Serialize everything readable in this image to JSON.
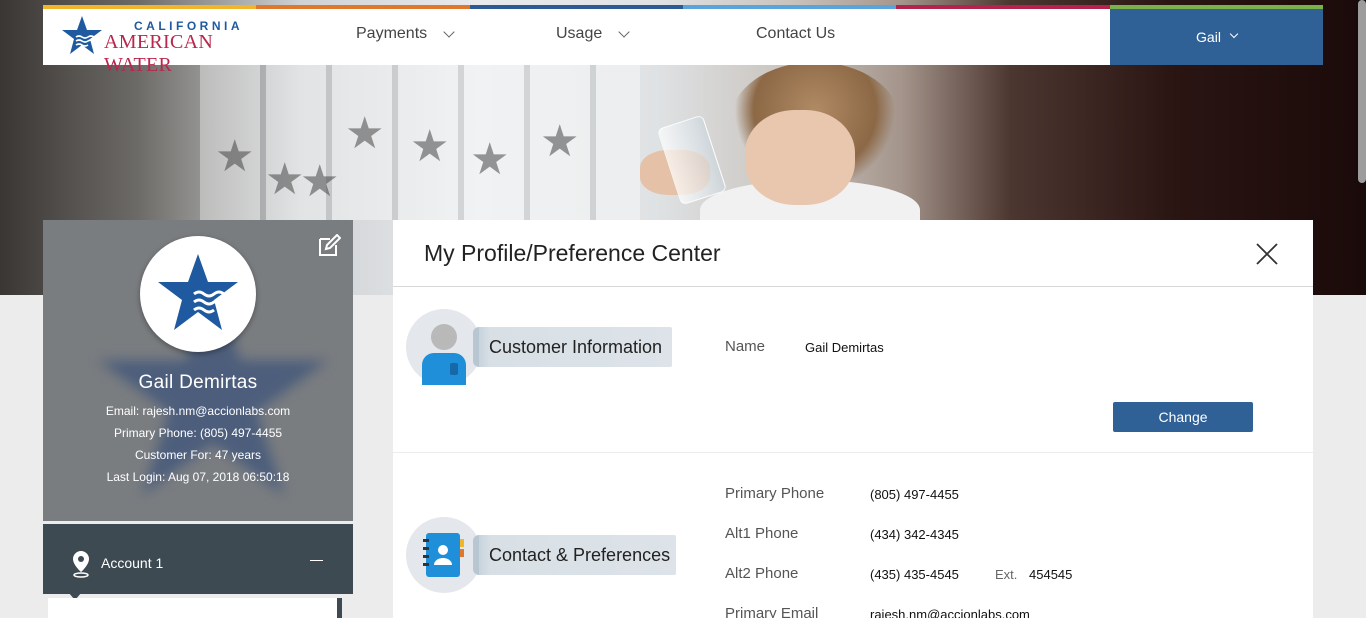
{
  "brand": {
    "logo_line1": "CALIFORNIA",
    "logo_line2": "AMERICAN WATER",
    "colors": {
      "primary": "#2f6197",
      "accent": "#b8274d",
      "stripe": [
        "#f1b52b",
        "#e1772b",
        "#2b5a94",
        "#5aa4dc",
        "#b3234e",
        "#7bb14a"
      ]
    }
  },
  "nav": {
    "items": [
      {
        "label": "Payments",
        "has_dropdown": true
      },
      {
        "label": "Usage",
        "has_dropdown": true
      },
      {
        "label": "Contact Us",
        "has_dropdown": false
      }
    ],
    "user_menu": {
      "label": "Gail"
    }
  },
  "profile_card": {
    "name": "Gail Demirtas",
    "email": "Email: rajesh.nm@accionlabs.com",
    "primary_phone": "Primary Phone: (805) 497-4455",
    "customer_for": "Customer For: 47 years",
    "last_login": "Last Login: Aug 07, 2018 06:50:18",
    "edit_icon": "edit-icon"
  },
  "account": {
    "label": "Account 1",
    "pin_icon": "map-pin-icon",
    "collapse_icon": "minus-icon"
  },
  "panel": {
    "title": "My Profile/Preference Center",
    "close_icon": "close-icon",
    "customer_info": {
      "heading": "Customer Information",
      "icon": "person-icon",
      "name_label": "Name",
      "name_value": "Gail Demirtas",
      "change_label": "Change"
    },
    "contact_prefs": {
      "heading": "Contact & Preferences",
      "icon": "address-book-icon",
      "rows": [
        {
          "label": "Primary Phone",
          "value": "(805) 497-4455"
        },
        {
          "label": "Alt1 Phone",
          "value": "(434) 342-4345"
        },
        {
          "label": "Alt2 Phone",
          "value": "(435) 435-4545",
          "ext_label": "Ext.",
          "ext_value": "454545"
        },
        {
          "label": "Primary Email",
          "value": "rajesh.nm@accionlabs.com"
        }
      ]
    }
  }
}
